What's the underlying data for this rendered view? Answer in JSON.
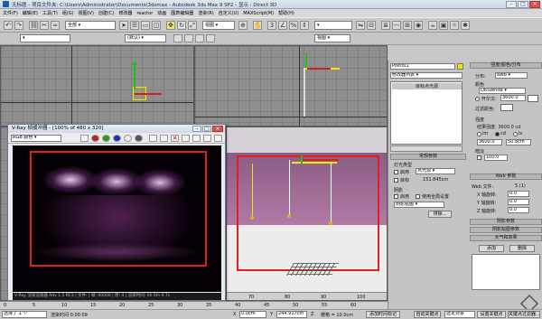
{
  "window": {
    "title": "无标题   - 项目文件夹: C:\\Users\\Administrator\\Documents\\3dsmax   - Autodesk 3ds Max 9 SP2   - 显示 : Direct 3D"
  },
  "menu": [
    "文件(F)",
    "编辑(E)",
    "工具(T)",
    "组(G)",
    "视图(V)",
    "创建(C)",
    "修改器",
    "reactor",
    "动画",
    "图表编辑器",
    "渲染(R)",
    "自定义(U)",
    "MAXScript(M)",
    "帮助(H)"
  ],
  "toolbar": {
    "filter_select": "全部",
    "view_select": "视图",
    "named_sel": "",
    "coord_select": "视图"
  },
  "toolbar2": {
    "select1": "",
    "select2": "(默认)"
  },
  "viewports": {
    "bottom_right_ruler": [
      "70",
      "80",
      "90",
      "100"
    ]
  },
  "command_panel": {
    "object_name": "Point01",
    "modifier_list": "修改器列表",
    "stack_item": "目标点光源",
    "rollout_general": "常规参数",
    "light_type": "灯光类型",
    "enable_label": "启用",
    "light_type_value": "点光源",
    "targeted_label": "目标",
    "targeted_value": "151.845cm",
    "shadows": "阴影",
    "shadow_enable": "启用",
    "use_global": "使用全局设置",
    "shadow_type": "阴影贴图",
    "exclude_btn": "排除...",
    "rollout_intensity": "强度/颜色/分布",
    "distribution": "分布:",
    "distribution_value": "Web",
    "color": "颜色",
    "color_value": "D65White",
    "kelvin": "开尔文:",
    "kelvin_value": "3600.0",
    "filter_color": "过滤颜色:",
    "intensity": "强度",
    "result_intensity": "结果强度: 3600.0 cd",
    "unit_lm": "lm",
    "unit_cd": "cd",
    "unit_lx": "lx",
    "intensity_value": "3600.0",
    "intensity_at": "50.8cm",
    "dimming": "暗淡",
    "dim_percent": "100.0",
    "rollout_web": "Web 参数",
    "web_file": "Web 文件:",
    "web_file_value": "5 (1)",
    "x_rot": "X 轴旋转:",
    "y_rot": "Y 轴旋转:",
    "z_rot": "Z 轴旋转:",
    "rot_value": "0.0",
    "rollout_shadow_params": "阴影参数",
    "rollout_shadow_map": "阴影贴图参数",
    "rollout_atmos": "大气和效果",
    "add_btn": "添加",
    "delete_btn": "删除"
  },
  "vray_window": {
    "title": "V-Ray 帧缓冲器 - [100% of 480 x 320]",
    "channel": "RGB 颜色",
    "status": "V-Ray 渲染渲染器 Adv 1.5 RC3 | 文件: | 帧: 00000 | 原: 4 | 渲染时间: 0h 0m 9.7s"
  },
  "timeline": {
    "ruler": [
      "0",
      "5",
      "10",
      "15",
      "20",
      "25",
      "30",
      "35",
      "40",
      "45",
      "50",
      "55",
      "60"
    ]
  },
  "status_bar": {
    "selected": "选择了 1 个",
    "render_time": "渲染时间  0:00:09",
    "x_label": "X",
    "x_value": "0.0cm",
    "y_label": "Y",
    "y_value": "244.917cm",
    "z_label": "Z",
    "grid": "栅格 = 10.0cm",
    "add_time_tag": "添加时间标记",
    "autokey": "自动关键点",
    "selected_obj": "选定对象",
    "set_key": "设置关键点",
    "key_filters": "关键点过滤器..."
  },
  "colors": {
    "highlight_red": "#e02020",
    "viewport_yellow": "#f0e800",
    "selection_blue": "#3a5fd8",
    "pink_floor": "#b07aa5"
  }
}
